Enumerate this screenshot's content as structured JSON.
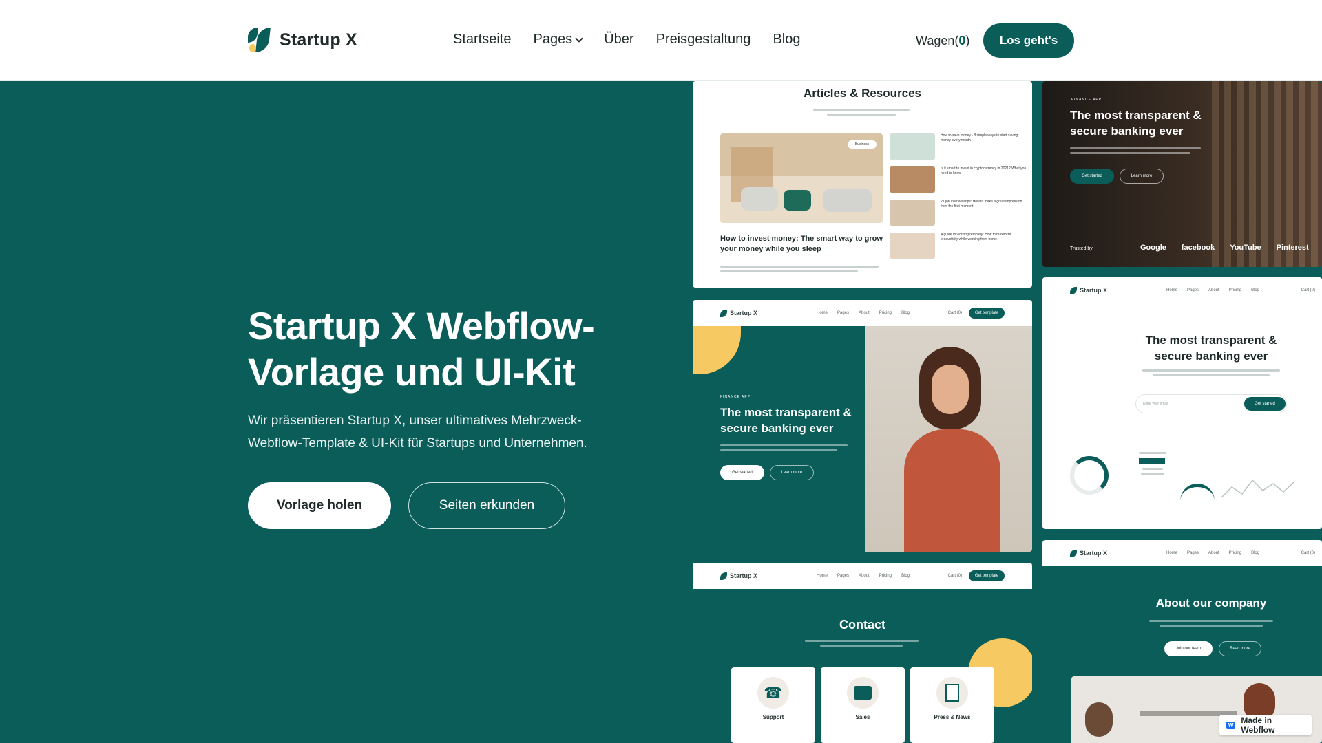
{
  "brand": {
    "name": "Startup X"
  },
  "nav": {
    "items": [
      "Startseite",
      "Pages",
      "Über",
      "Preisgestaltung",
      "Blog"
    ],
    "cart_label": "Wagen",
    "cart_count": "0",
    "cta": "Los geht's"
  },
  "hero": {
    "title": "Startup X Webflow-Vorlage und UI-Kit",
    "subtitle": "Wir präsentieren Startup X, unser ultimatives Mehrzweck-Webflow-Template & UI-Kit für Startups und Unternehmen.",
    "primary_button": "Vorlage holen",
    "secondary_button": "Seiten erkunden"
  },
  "previews": {
    "articles": {
      "title": "Articles & Resources",
      "badge": "Business",
      "featured_title": "How to invest money: The smart way to grow your money while you sleep",
      "side_items": [
        "How to save money - 8 simple ways to start saving money every month",
        "Is it smart to invest in cryptocurrency in 2021? What you need to know",
        "21 job interview tips: How to make a great impression from the first moment",
        "A guide to working remotely: How to maximize productivity while working from home"
      ]
    },
    "banking_dark": {
      "kicker": "FINANCE APP",
      "title": "The most transparent & secure banking ever",
      "btn1": "Get started",
      "btn2": "Learn more",
      "trusted": "Trusted by",
      "logos": [
        "Google",
        "facebook",
        "YouTube",
        "Pinterest"
      ]
    },
    "mini_nav": {
      "brand": "Startup X",
      "links": [
        "Home",
        "Pages",
        "About",
        "Pricing",
        "Blog"
      ],
      "cart": "Cart (0)",
      "cta": "Get template"
    },
    "finance_hero": {
      "kicker": "FINANCE APP",
      "title": "The most transparent & secure banking ever",
      "btn1": "Get started",
      "btn2": "Learn more"
    },
    "banking_light": {
      "title": "The most transparent & secure banking ever",
      "input_placeholder": "Enter your email",
      "btn": "Get started"
    },
    "contact": {
      "title": "Contact",
      "cards": [
        "Support",
        "Sales",
        "Press & News"
      ]
    },
    "about": {
      "title": "About our company",
      "btn1": "Join our team",
      "btn2": "Read more"
    }
  },
  "badge": {
    "label": "Made in Webflow"
  }
}
